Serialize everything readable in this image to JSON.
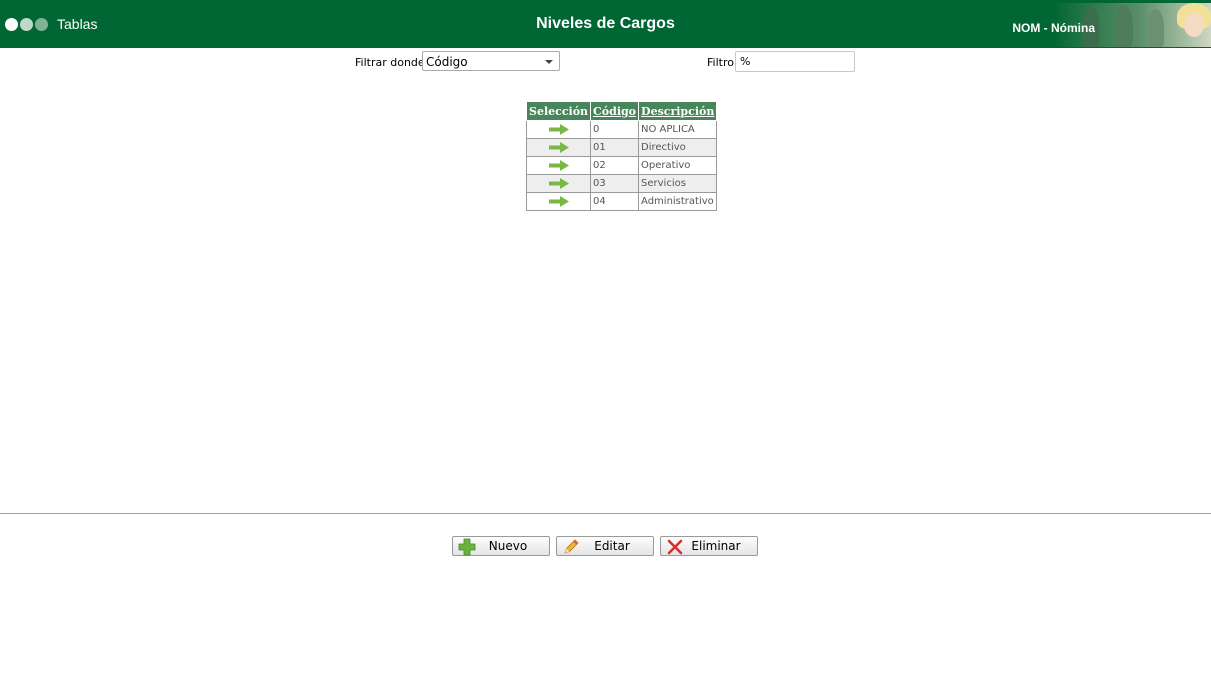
{
  "header": {
    "app_title": "Tablas",
    "page_title": "Niveles de Cargos",
    "module_label": "NOM - Nómina"
  },
  "filter": {
    "field_label": "Filtrar donde",
    "field_selected": "Código",
    "value_label": "Filtro",
    "value": "%"
  },
  "table": {
    "columns": [
      "Selección",
      "Código",
      "Descripción"
    ],
    "rows": [
      {
        "code": "0",
        "description": "NO APLICA"
      },
      {
        "code": "01",
        "description": "Directivo"
      },
      {
        "code": "02",
        "description": "Operativo"
      },
      {
        "code": "03",
        "description": "Servicios"
      },
      {
        "code": "04",
        "description": "Administrativo"
      }
    ]
  },
  "buttons": {
    "new_label": "Nuevo",
    "edit_label": "Editar",
    "delete_label": "Eliminar"
  },
  "colors": {
    "header_bg": "#006633",
    "table_header_bg": "#48855a",
    "select_arrow": "#7ab648"
  },
  "icons": {
    "select_arrow": "arrow-right-icon",
    "new": "plus-icon",
    "edit": "pencil-icon",
    "delete": "x-icon"
  }
}
